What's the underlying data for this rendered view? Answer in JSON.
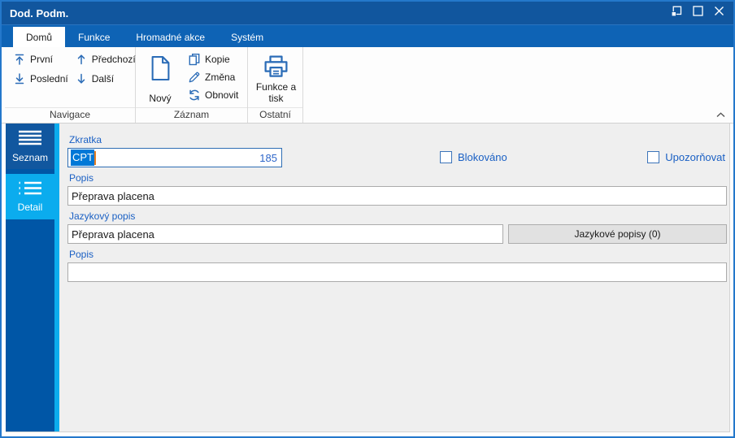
{
  "window": {
    "title": "Dod. Podm."
  },
  "ribbon": {
    "tabs": [
      {
        "label": "Domů",
        "active": true
      },
      {
        "label": "Funkce",
        "active": false
      },
      {
        "label": "Hromadné akce",
        "active": false
      },
      {
        "label": "Systém",
        "active": false
      }
    ],
    "groups": [
      {
        "label": "Navigace",
        "buttons": [
          {
            "label": "První",
            "icon": "arrow-bar-up-icon"
          },
          {
            "label": "Poslední",
            "icon": "arrow-bar-down-icon"
          },
          {
            "label": "Předchozí",
            "icon": "arrow-up-icon"
          },
          {
            "label": "Další",
            "icon": "arrow-down-icon"
          }
        ]
      },
      {
        "label": "Záznam",
        "big_button": {
          "label": "Nový",
          "icon": "new-document-icon"
        },
        "buttons": [
          {
            "label": "Kopie",
            "icon": "copy-icon"
          },
          {
            "label": "Změna",
            "icon": "pencil-icon"
          },
          {
            "label": "Obnovit",
            "icon": "refresh-icon"
          }
        ]
      },
      {
        "label": "Ostatní",
        "big_button": {
          "label": "Funkce a tisk",
          "icon": "printer-icon"
        }
      }
    ]
  },
  "sidebar": {
    "items": [
      {
        "label": "Seznam",
        "icon": "list-icon",
        "active": false
      },
      {
        "label": "Detail",
        "icon": "detail-list-icon",
        "active": true
      }
    ]
  },
  "form": {
    "zkratka": {
      "label": "Zkratka",
      "value": "CPT",
      "code": "185",
      "selected": true
    },
    "blokovano": {
      "label": "Blokováno",
      "checked": false
    },
    "upozornovat": {
      "label": "Upozorňovat",
      "checked": false
    },
    "popis": {
      "label": "Popis",
      "value": "Přeprava placena"
    },
    "jazykovy_popis": {
      "label": "Jazykový popis",
      "value": "Přeprava placena",
      "button_label": "Jazykové popisy (0)"
    },
    "popis2": {
      "label": "Popis",
      "value": ""
    }
  },
  "colors": {
    "titlebar": "#11569E",
    "tabstrip": "#0E63B5",
    "window_border": "#2478CB",
    "sidebar": "#0056A6",
    "accent_cyan": "#0BACEE",
    "selection_blue": "#0078D7",
    "caret_orange": "#E67E22",
    "label_blue": "#1A60C4",
    "icon_blue": "#2B6CB7"
  }
}
